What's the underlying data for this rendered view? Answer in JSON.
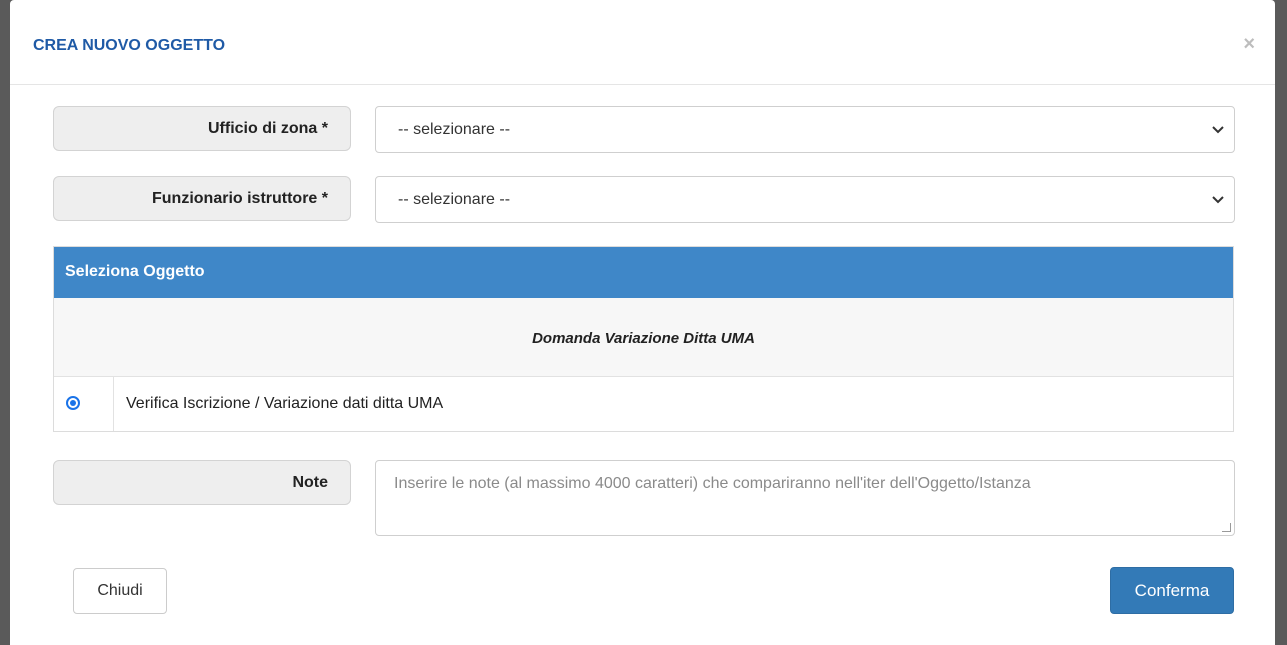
{
  "modal": {
    "title": "CREA NUOVO OGGETTO",
    "close_glyph": "×"
  },
  "form": {
    "ufficio": {
      "label": "Ufficio di zona *",
      "value": "-- selezionare --"
    },
    "funzionario": {
      "label": "Funzionario istruttore *",
      "value": "-- selezionare --"
    }
  },
  "panel": {
    "title": "Seleziona Oggetto",
    "group": "Domanda Variazione Ditta UMA",
    "option": {
      "label": "Verifica Iscrizione / Variazione dati ditta UMA",
      "selected": true
    }
  },
  "note": {
    "label": "Note",
    "placeholder": "Inserire le note (al massimo 4000 caratteri) che compariranno nell'iter dell'Oggetto/Istanza"
  },
  "buttons": {
    "close": "Chiudi",
    "confirm": "Conferma"
  },
  "colors": {
    "title": "#1f5aa6",
    "panel_header": "#3f87c8",
    "confirm_button": "#337ab7",
    "radio": "#1a73e8"
  },
  "icons": {
    "close": "close-icon",
    "select_arrow": "chevron-down-icon",
    "radio": "radio-selected-icon"
  }
}
